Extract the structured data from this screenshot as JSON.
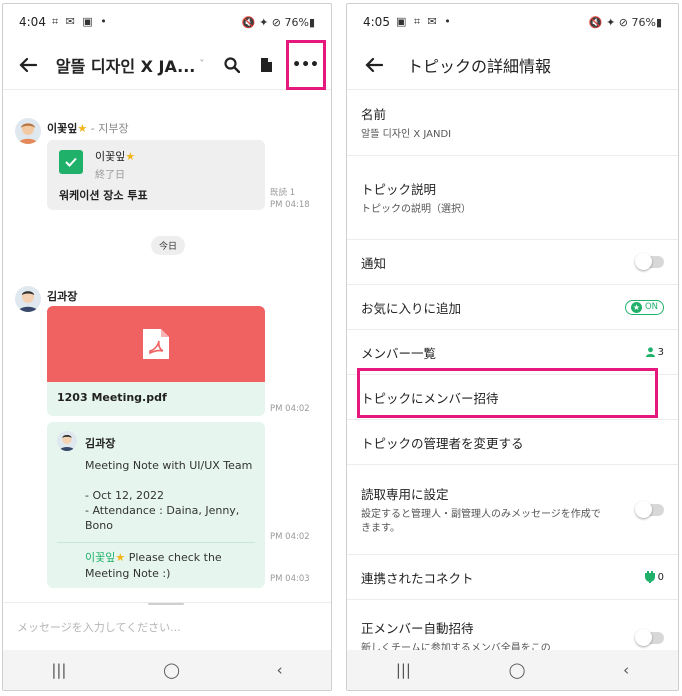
{
  "left": {
    "status": {
      "time": "4:04",
      "left_icons": "⌗ ✉ ▣ •",
      "right_icons": "🔇 ✦ ⊘ 76%▮"
    },
    "appbar": {
      "title": "알뜰 디자인 X JA...",
      "caret": "˅",
      "more": "•••"
    },
    "messages": {
      "msg1": {
        "sender": "이꽃잎",
        "star": "★",
        "role": " - 지부장",
        "card_name": "이꽃잎",
        "card_status": "終了日",
        "card_title": "워케이션 장소 투표",
        "read": "既読 1",
        "time": "PM 04:18"
      },
      "today": "今日",
      "msg2": {
        "sender": "김과장",
        "file_name": "1203 Meeting.pdf",
        "file_time": "PM 04:02",
        "quote_sender": "김과장",
        "quote_lines": [
          "Meeting Note with UI/UX Team",
          "",
          "- Oct 12, 2022",
          "- Attendance : Daina, Jenny,",
          "Bono"
        ],
        "quote_time": "PM 04:02",
        "reply_mention": "이꽃잎",
        "reply_text_1": " Please check the",
        "reply_text_2": "Meeting Note :)",
        "reply_time": "PM 04:03"
      }
    },
    "composer": {
      "placeholder": "メッセージを入力してください..."
    }
  },
  "right": {
    "status": {
      "time": "4:05",
      "left_icons": "▣ ⌗ ✉ •",
      "right_icons": "🔇 ✦ ⊘ 76%▮"
    },
    "appbar": {
      "title": "トピックの詳細情報"
    },
    "rows": {
      "name_label": "名前",
      "name_value": "알뜰 디자인 X JANDI",
      "desc_label": "トピック説明",
      "desc_value": "トピックの説明（選択）",
      "notify_label": "通知",
      "favorite_label": "お気に入りに追加",
      "favorite_state": "ON",
      "members_label": "メンバー一覧",
      "members_count": "3",
      "invite_label": "トピックにメンバー招待",
      "admin_label": "トピックの管理者を変更する",
      "readonly_label": "読取専用に設定",
      "readonly_desc": "設定すると管理人・副管理人のみメッセージを作成できます。",
      "connect_label": "連携されたコネクト",
      "connect_count": "0",
      "autoinvite_label": "正メンバー自動招待",
      "autoinvite_desc": "新しくチームに参加するメンバ全員をこの"
    }
  },
  "nav": {
    "recent": "|||",
    "home": "◯",
    "back": "‹"
  },
  "colors": {
    "accent": "#1fb16a",
    "highlight": "#e6177d",
    "pdf_red": "#f06262",
    "quote_bg": "#e6f6ee"
  }
}
